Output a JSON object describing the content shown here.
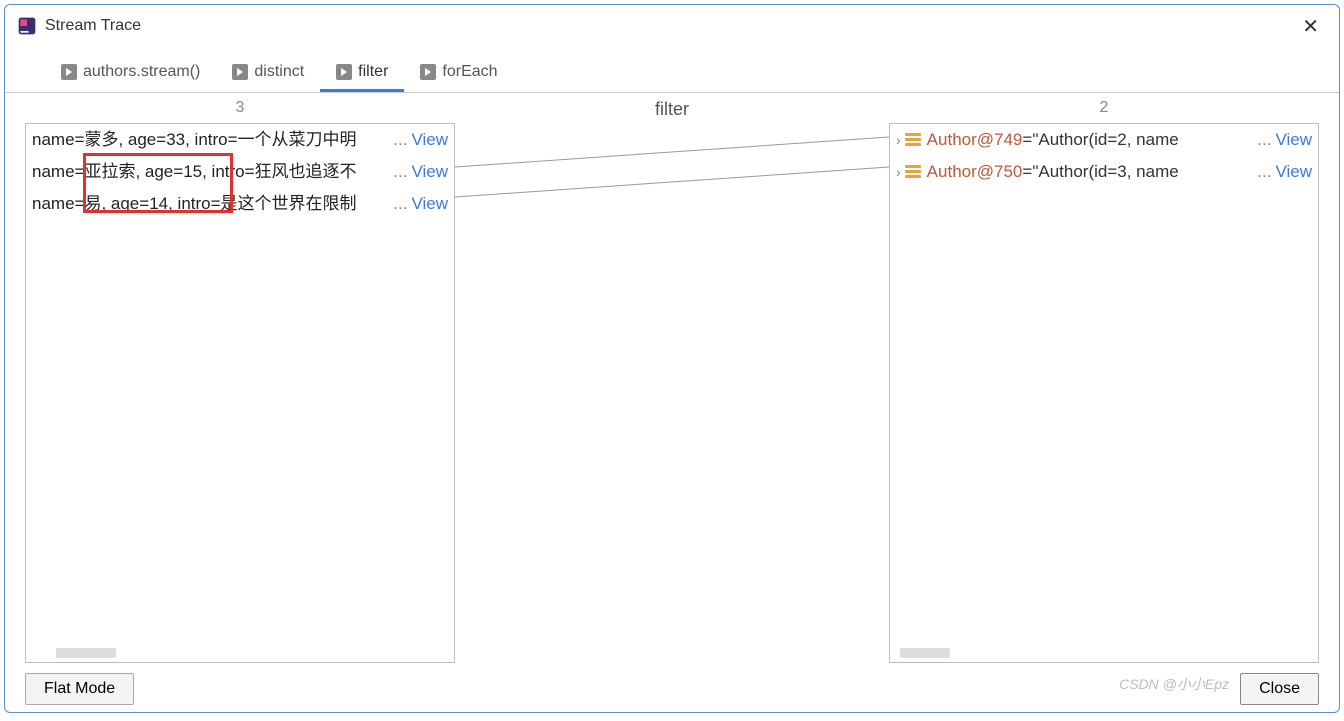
{
  "window": {
    "title": "Stream Trace"
  },
  "tabs": [
    {
      "label": "authors.stream()"
    },
    {
      "label": "distinct"
    },
    {
      "label": "filter",
      "active": true
    },
    {
      "label": "forEach"
    }
  ],
  "left": {
    "count": "3",
    "rows": [
      {
        "text": "name=蒙多, age=33, intro=一个从菜刀中明",
        "view": "View"
      },
      {
        "text": "name=亚拉索, age=15, intro=狂风也追逐不",
        "view": "View"
      },
      {
        "text": "name=易, age=14, intro=是这个世界在限制",
        "view": "View"
      }
    ]
  },
  "mid": {
    "title": "filter"
  },
  "right": {
    "count": "2",
    "rows": [
      {
        "obj": "Author@749",
        "eq": " = ",
        "val": "\"Author(id=2, name",
        "view": "View"
      },
      {
        "obj": "Author@750",
        "eq": " = ",
        "val": "\"Author(id=3, name",
        "view": "View"
      }
    ]
  },
  "footer": {
    "flat": "Flat Mode",
    "close": "Close"
  },
  "ellipsis": "...",
  "watermark": "CSDN @小小Epz"
}
